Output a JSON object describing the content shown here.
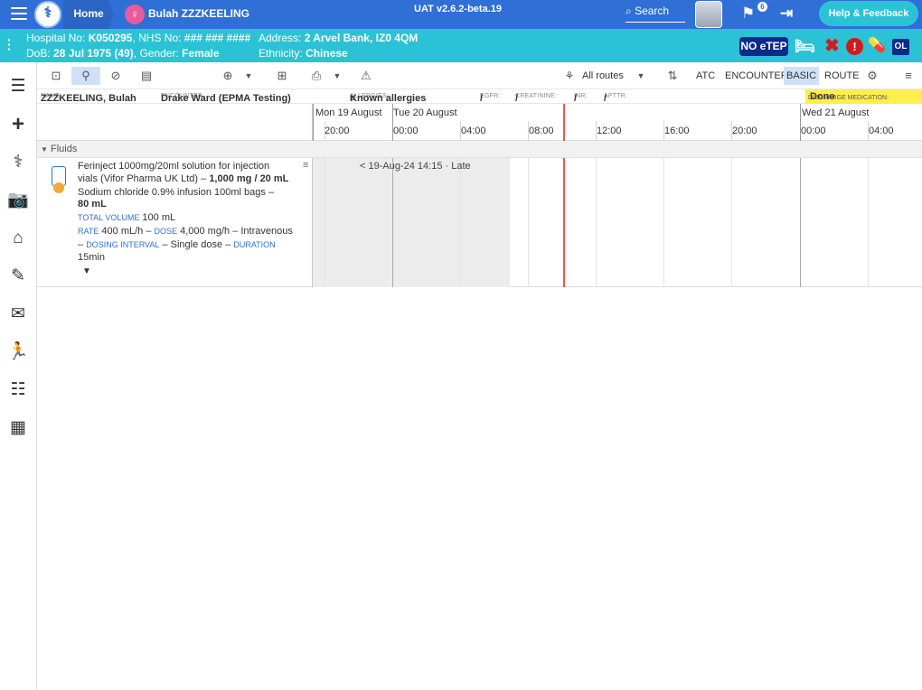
{
  "topbar": {
    "home": "Home",
    "patient_name": "Bulah ZZZKEELING",
    "version": "UAT v2.6.2-beta.19",
    "search": "Search",
    "notification_count": "6",
    "help": "Help & Feedback"
  },
  "patient": {
    "hospital_no_label": "Hospital No:",
    "hospital_no": "K050295",
    "nhs_no_label": "NHS No:",
    "nhs_no": "### ### ####",
    "address_label": "Address:",
    "address": "2 Arvel Bank, IZ0 4QM",
    "dob_label": "DoB:",
    "dob": "28 Jul 1975 (49)",
    "gender_label": "Gender:",
    "gender": "Female",
    "ethnicity_label": "Ethnicity:",
    "ethnicity": "Chinese",
    "etep": "NO eTEP",
    "ol": "OL"
  },
  "toolbar": {
    "routes": "All routes",
    "atc": "ATC",
    "encounter": "ENCOUNTER",
    "basic": "BASIC",
    "route": "ROUTE"
  },
  "infobar": {
    "name_label": "NAME",
    "name": "ZZZKEELING, Bulah",
    "encounter_label": "ENCOUNTER",
    "encounter": "Drake Ward (EPMA Testing)",
    "allergies_label": "ALLERGIES:",
    "allergies": "Known allergies",
    "egfr_label": "EGFR:",
    "egfr": "/",
    "creatinine_label": "CREATININE:",
    "creatinine": "/",
    "inr_label": "INR:",
    "inr": "/",
    "apttr_label": "APTTR:",
    "apttr": "/",
    "discharge_label": "DISCHARGE MEDICATION:",
    "discharge": "Done"
  },
  "timeline": {
    "days": [
      "Mon 19 August",
      "Tue 20 August",
      "Wed 21 August"
    ],
    "hours": [
      "20:00",
      "00:00",
      "04:00",
      "08:00",
      "12:00",
      "16:00",
      "20:00",
      "00:00",
      "04:00"
    ]
  },
  "group": {
    "label": "Fluids"
  },
  "prescription": {
    "line1": "Ferinject 1000mg/20ml solution for injection",
    "line2_pre": "vials (Vifor Pharma UK Ltd) –",
    "line2_bold": "1,000 mg / 20 mL",
    "line3": "Sodium chloride 0.9% infusion 100ml bags –",
    "line4_bold": "80 mL",
    "total_volume_label": "TOTAL VOLUME",
    "total_volume": "100 mL",
    "rate_label": "RATE",
    "rate": "400 mL/h –",
    "dose_label": "DOSE",
    "dose": "4,000 mg/h – Intravenous",
    "dash": "–",
    "dosing_interval_label": "DOSING INTERVAL",
    "dosing_interval": "– Single dose –",
    "duration_label": "DURATION",
    "duration": "15min",
    "late": "< 19-Aug-24 14:15 · Late"
  }
}
